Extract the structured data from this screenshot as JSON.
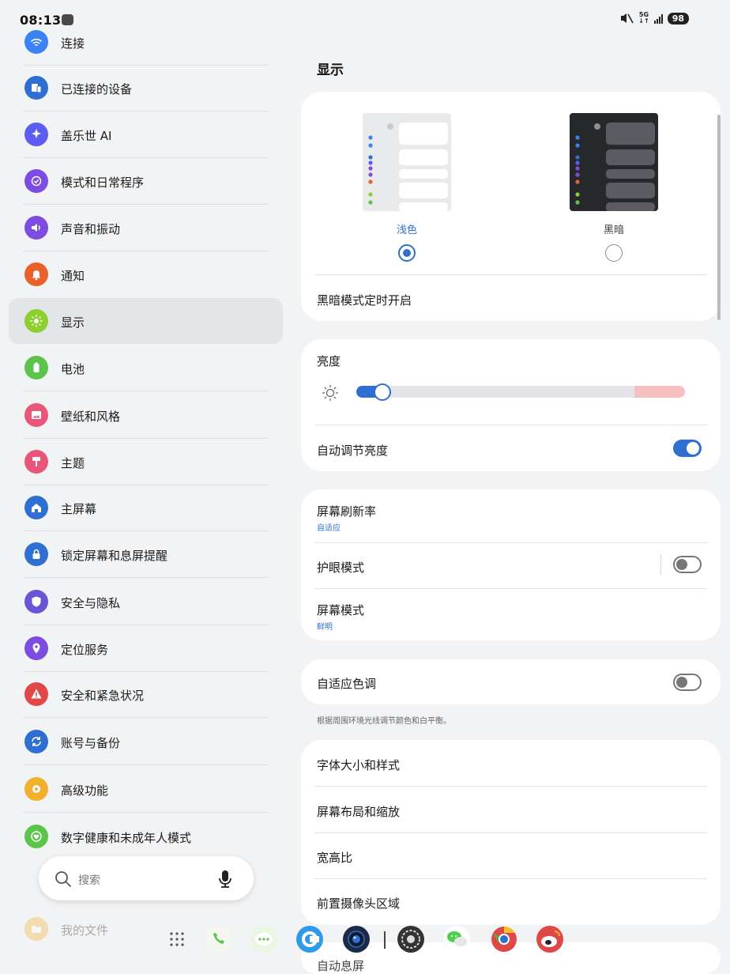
{
  "status_bar": {
    "time": "08:13",
    "network": "5G",
    "battery": "98"
  },
  "sidebar": {
    "items": [
      {
        "label": "连接",
        "icon": "wifi-icon",
        "color": "#3b82f6"
      },
      {
        "label": "已连接的设备",
        "icon": "devices-icon",
        "color": "#2f6fd1"
      },
      {
        "label": "盖乐世 AI",
        "icon": "sparkle-ai-icon",
        "color": "#5b5ef0"
      },
      {
        "label": "模式和日常程序",
        "icon": "check-circle-icon",
        "color": "#7c4de0"
      },
      {
        "label": "声音和振动",
        "icon": "speaker-icon",
        "color": "#7c4de0"
      },
      {
        "label": "通知",
        "icon": "bell-icon",
        "color": "#e8612c"
      },
      {
        "label": "显示",
        "icon": "sun-icon",
        "color": "#8ccf2e"
      },
      {
        "label": "电池",
        "icon": "battery-icon",
        "color": "#5cc44a"
      },
      {
        "label": "壁纸和风格",
        "icon": "image-icon",
        "color": "#e8567a"
      },
      {
        "label": "主题",
        "icon": "paint-brush-icon",
        "color": "#e8567a"
      },
      {
        "label": "主屏幕",
        "icon": "home-icon",
        "color": "#2f6fd1"
      },
      {
        "label": "锁定屏幕和息屏提醒",
        "icon": "lock-icon",
        "color": "#2f6fd1"
      },
      {
        "label": "安全与隐私",
        "icon": "shield-icon",
        "color": "#6b55d6"
      },
      {
        "label": "定位服务",
        "icon": "location-pin-icon",
        "color": "#7c4de0"
      },
      {
        "label": "安全和紧急状况",
        "icon": "alert-icon",
        "color": "#e04848"
      },
      {
        "label": "账号与备份",
        "icon": "sync-icon",
        "color": "#2f6fd1"
      },
      {
        "label": "高级功能",
        "icon": "gear-star-icon",
        "color": "#f2b02f"
      },
      {
        "label": "数字健康和未成年人模式",
        "icon": "heart-circle-icon",
        "color": "#5cc44a"
      },
      {
        "label": "我的文件",
        "icon": "folder-icon",
        "color": "#f2b02f"
      }
    ],
    "active_index": 6
  },
  "search": {
    "placeholder": "搜索"
  },
  "main": {
    "title": "显示",
    "theme": {
      "light_label": "浅色",
      "dark_label": "黑暗",
      "selected": "light"
    },
    "dark_schedule_label": "黑暗模式定时开启",
    "brightness": {
      "label": "亮度",
      "value": 0.08
    },
    "auto_brightness": {
      "label": "自动调节亮度",
      "on": true
    },
    "refresh_rate": {
      "label": "屏幕刷新率",
      "value": "自适应"
    },
    "eye_comfort": {
      "label": "护眼模式",
      "on": false
    },
    "screen_mode": {
      "label": "屏幕模式",
      "value": "鲜明"
    },
    "adaptive_color": {
      "label": "自适应色调",
      "on": false,
      "note": "根据周围环境光线调节颜色和白平衡。"
    },
    "more": [
      {
        "label": "字体大小和样式"
      },
      {
        "label": "屏幕布局和缩放"
      },
      {
        "label": "宽高比"
      },
      {
        "label": "前置摄像头区域"
      },
      {
        "label": "自动息屏"
      }
    ]
  },
  "dock": {
    "apps": [
      {
        "name": "app-drawer-icon",
        "color": "#555555"
      },
      {
        "name": "phone-icon",
        "color": "#5cc44a"
      },
      {
        "name": "messages-icon",
        "color": "#5cc44a"
      },
      {
        "name": "browser-icon",
        "color": "#2f9ae8"
      },
      {
        "name": "camera-icon",
        "color": "#1a2a4a"
      },
      {
        "name": "settings-app-icon",
        "color": "#333333"
      },
      {
        "name": "wechat-icon",
        "color": "#4cd14c"
      },
      {
        "name": "chrome-icon",
        "color": "#e8a02f"
      },
      {
        "name": "weibo-icon",
        "color": "#e04848"
      }
    ]
  }
}
